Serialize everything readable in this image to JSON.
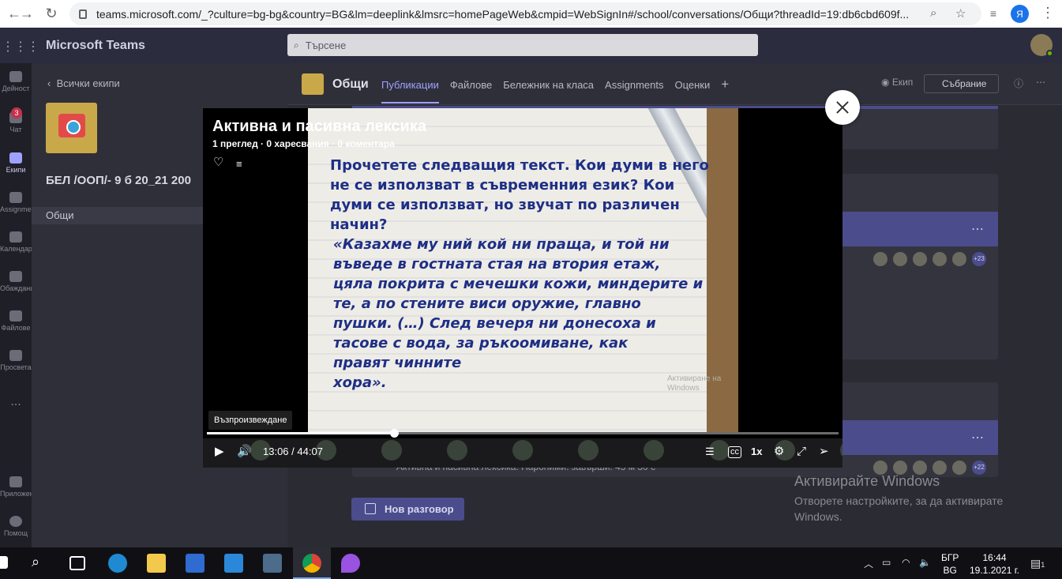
{
  "browser": {
    "url": "teams.microsoft.com/_?culture=bg-bg&country=BG&lm=deeplink&lmsrc=homePageWeb&cmpid=WebSignIn#/school/conversations/Общи?threadId=19:db6cbd609f...",
    "profile_initial": "Я"
  },
  "teams": {
    "app_title": "Microsoft Teams",
    "search_placeholder": "Търсене"
  },
  "rail": {
    "items": [
      {
        "label": "Дейност"
      },
      {
        "label": "Чат",
        "badge": "3"
      },
      {
        "label": "Екипи"
      },
      {
        "label": "Assignments"
      },
      {
        "label": "Календар"
      },
      {
        "label": "Обаждания"
      },
      {
        "label": "Файлове"
      },
      {
        "label": "Просвета"
      },
      {
        "label": "..."
      },
      {
        "label": "Приложения"
      },
      {
        "label": "Помощ"
      }
    ]
  },
  "team_panel": {
    "back_label": "Всички екипи",
    "team_name": "БЕЛ /ООП/- 9 б 20_21 200",
    "channel": "Общи"
  },
  "channel": {
    "title": "Общи",
    "tabs": [
      "Публикации",
      "Файлове",
      "Бележник на класа",
      "Assignments",
      "Оценки"
    ],
    "add_tab": "+",
    "team_btn": "Екип",
    "meet_btn": "Събрание",
    "avatar_more_1": "+23",
    "avatar_more_2": "+22",
    "snippet": "Активна и пасивна лексика. Пароними. завърши: 45 м 30 с",
    "new_conversation": "Нов разговор"
  },
  "video": {
    "title": "Активна и пасивна лексика",
    "stats": "1 преглед · 0 харесвания · 0 коментара",
    "slide_lines": [
      "Прочетете следващия текст. Кои думи в него",
      "не се използват в съвременния език? Кои",
      "думи се използват, но звучат по различен",
      "начин?"
    ],
    "slide_quote": [
      "«Казахме му ний кой ни праща, и той ни",
      "въведе в гостната стая на втория етаж,",
      "цяла покрита с мечешки кожи, миндерите и",
      "те, а по стените виси оружие, главно",
      "пушки. (…) След вечеря ни донесоха и",
      "тасове с вода, за ръкоомиване, как",
      "правят чинните",
      "хора»."
    ],
    "watermark": "Активиране на Windows",
    "tooltip": "Възпроизвеждане",
    "current_time": "13:06",
    "separator": "/",
    "duration": "44:07",
    "progress_fraction": 0.296,
    "speed": "1x"
  },
  "windows": {
    "activate_title": "Активирайте Windows",
    "activate_text": "Отворете настройките, за да активирате Windows.",
    "lang_top": "БГР",
    "lang_bottom": "BG",
    "time": "16:44",
    "date": "19.1.2021 г.",
    "notif_count": "1"
  },
  "colors": {
    "teams_accent": "#4b4c8c",
    "tab_active": "#9ea2ff",
    "slide_text": "#1e2f86"
  }
}
